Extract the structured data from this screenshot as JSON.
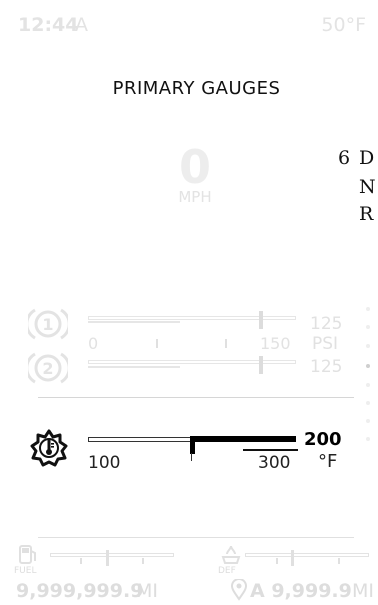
{
  "status": {
    "time": "12:44",
    "ampm": "A",
    "ambient_temp": "50°F"
  },
  "page_title": "PRIMARY GAUGES",
  "speed": {
    "value": "0",
    "unit": "MPH"
  },
  "transmission": {
    "gear_number": "6",
    "gears": [
      "D",
      "N",
      "R"
    ],
    "selected": "D"
  },
  "page_indicator": {
    "count": 8,
    "active_index": 4
  },
  "air_pressure": {
    "gauge1_label": "1",
    "gauge2_label": "2",
    "gauge1_value": "125",
    "gauge2_value": "125",
    "unit": "PSI",
    "scale_min": "0",
    "scale_max": "150",
    "gauge1_level": 0.83,
    "gauge2_level": 0.83
  },
  "coolant_temp": {
    "value": "200",
    "unit": "°F",
    "scale_min": "100",
    "scale_max": "300",
    "level": 0.5
  },
  "fuel": {
    "label": "FUEL",
    "level": 0.25
  },
  "def": {
    "label": "DEF",
    "level": 0.45
  },
  "odometer": {
    "value": "9,999,999.9",
    "unit": "MI"
  },
  "trip": {
    "label": "A 9,999.9",
    "unit": "MI"
  }
}
